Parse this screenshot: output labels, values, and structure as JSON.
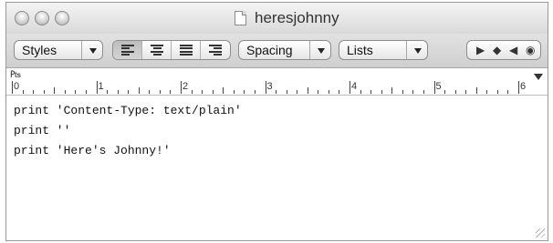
{
  "window": {
    "title": "heresjohnny"
  },
  "toolbar": {
    "styles_label": "Styles",
    "spacing_label": "Spacing",
    "lists_label": "Lists",
    "alignment": [
      "align-left",
      "align-center",
      "align-justify",
      "align-right"
    ],
    "selected_alignment": "align-left",
    "nav": [
      "play-icon",
      "diamond-icon",
      "back-icon",
      "record-icon"
    ]
  },
  "ruler": {
    "numbers": [
      "0",
      "1",
      "2",
      "3",
      "4",
      "5",
      "6"
    ]
  },
  "document": {
    "lines": [
      "print 'Content-Type: text/plain'",
      "print ''",
      "print 'Here's Johnny!'"
    ]
  }
}
